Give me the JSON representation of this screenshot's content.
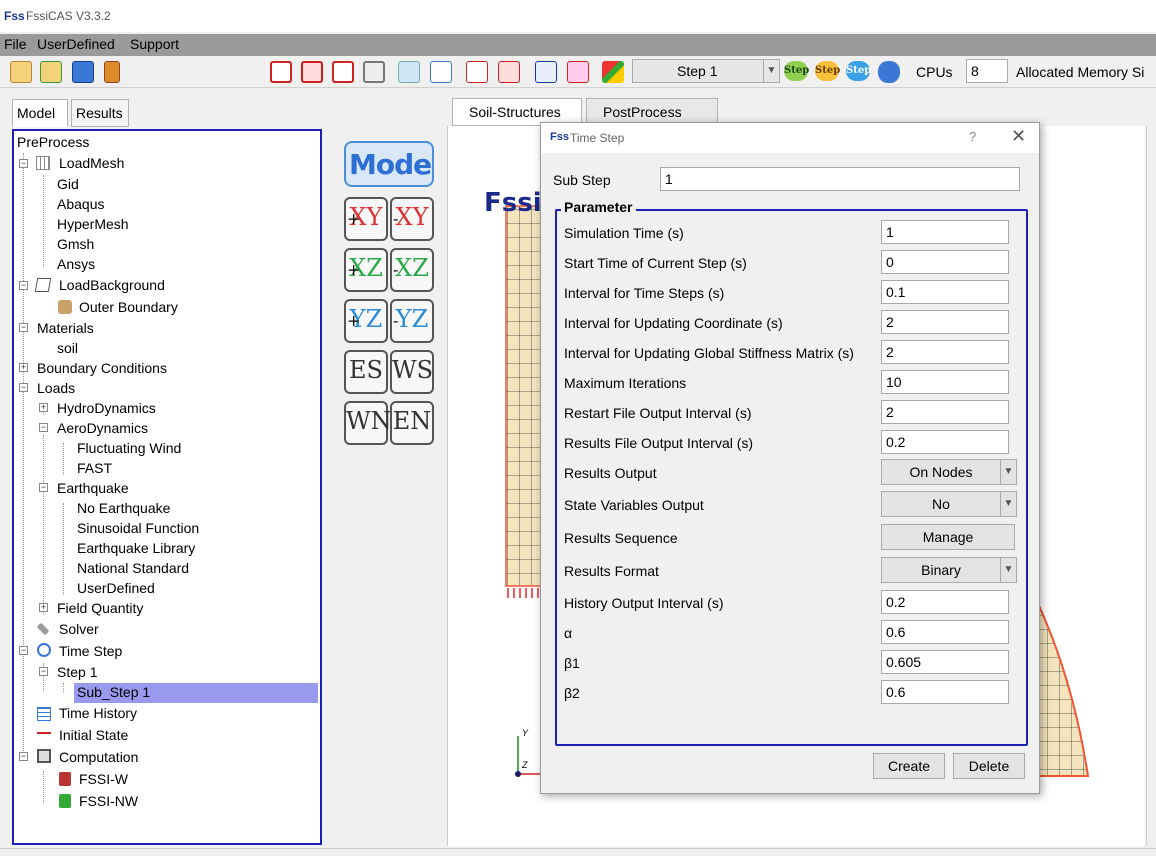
{
  "window": {
    "title": "FssiCAS V3.3.2",
    "logo_text": "Fss"
  },
  "menu": [
    "File",
    "UserDefined",
    "Support"
  ],
  "toolbar": {
    "step_select": "Step 1",
    "step_buttons": [
      "Step",
      "Step",
      "Step"
    ],
    "cpus_label": "CPUs",
    "cpus_value": "8",
    "memory_label": "Allocated Memory Si"
  },
  "left_tabs": [
    "Model",
    "Results"
  ],
  "tree": {
    "preprocess": "PreProcess",
    "loadmesh": "LoadMesh",
    "mesh_items": [
      "Gid",
      "Abaqus",
      "HyperMesh",
      "Gmsh",
      "Ansys"
    ],
    "loadbackground": "LoadBackground",
    "outer_boundary": "Outer Boundary",
    "materials": "Materials",
    "soil": "soil",
    "boundary_conditions": "Boundary Conditions",
    "loads": "Loads",
    "hydrodynamics": "HydroDynamics",
    "aerodynamics": "AeroDynamics",
    "aero_items": [
      "Fluctuating Wind",
      "FAST"
    ],
    "earthquake": "Earthquake",
    "eq_items": [
      "No Earthquake",
      "Sinusoidal Function",
      "Earthquake Library",
      "National Standard",
      "UserDefined"
    ],
    "field_quantity": "Field Quantity",
    "solver": "Solver",
    "time_step": "Time Step",
    "step1": "Step 1",
    "sub_step1": "Sub_Step 1",
    "time_history": "Time History",
    "initial_state": "Initial State",
    "computation": "Computation",
    "fssi_w": "FSSI-W",
    "fssi_nw": "FSSI-NW"
  },
  "view_tools": {
    "mode_label": "Mode",
    "axes": [
      {
        "sign": "+",
        "axis": "XY"
      },
      {
        "sign": "-",
        "axis": "XY"
      },
      {
        "sign": "+",
        "axis": "XZ"
      },
      {
        "sign": "-",
        "axis": "XZ"
      },
      {
        "sign": "+",
        "axis": "YZ"
      },
      {
        "sign": "-",
        "axis": "YZ"
      },
      {
        "sign": "",
        "axis": "ES"
      },
      {
        "sign": "",
        "axis": "WS"
      },
      {
        "sign": "",
        "axis": "WN"
      },
      {
        "sign": "",
        "axis": "EN"
      }
    ]
  },
  "right_tabs": [
    "Soil-Structures",
    "PostProcess"
  ],
  "viewport": {
    "logo": "Fssi",
    "axis_y": "Y",
    "axis_z": "Z"
  },
  "dialog": {
    "title": "Time Step",
    "help": "?",
    "close": "✕",
    "sub_step_label": "Sub Step",
    "sub_step_value": "1",
    "group_title": "Parameter",
    "fields": [
      {
        "label": "Simulation Time (s)",
        "value": "1"
      },
      {
        "label": "Start Time of Current Step (s)",
        "value": "0"
      },
      {
        "label": "Interval for Time Steps (s)",
        "value": "0.1"
      },
      {
        "label": "Interval for Updating Coordinate (s)",
        "value": "2"
      },
      {
        "label": "Interval for Updating Global Stiffness Matrix (s)",
        "value": "2"
      },
      {
        "label": "Maximum Iterations",
        "value": "10"
      },
      {
        "label": "Restart File Output Interval (s)",
        "value": "2"
      },
      {
        "label": "Results File Output Interval (s)",
        "value": "0.2"
      }
    ],
    "results_output_label": "Results Output",
    "results_output_value": "On Nodes",
    "state_vars_label": "State Variables Output",
    "state_vars_value": "No",
    "results_sequence_label": "Results Sequence",
    "manage_button": "Manage",
    "results_format_label": "Results Format",
    "results_format_value": "Binary",
    "history_fields": [
      {
        "label": "History Output Interval (s)",
        "value": "0.2"
      },
      {
        "label": "α",
        "value": "0.6"
      },
      {
        "label": "β1",
        "value": "0.605"
      },
      {
        "label": "β2",
        "value": "0.6"
      }
    ],
    "create_button": "Create",
    "delete_button": "Delete"
  }
}
